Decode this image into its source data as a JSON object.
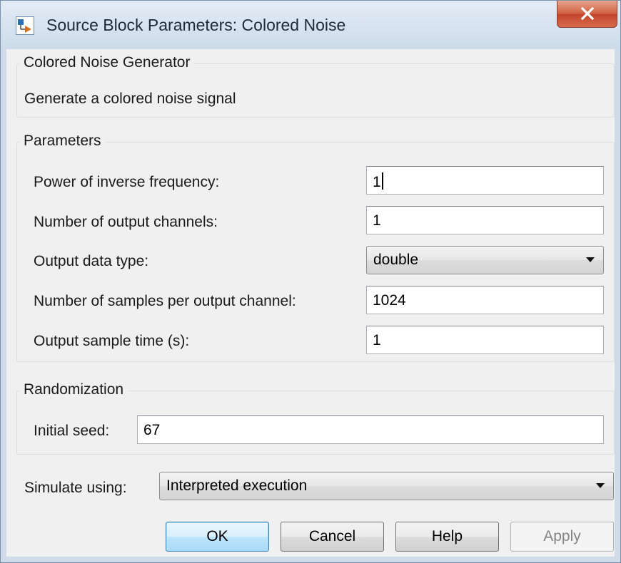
{
  "window": {
    "title": "Source Block Parameters: Colored Noise",
    "close_glyph": "X",
    "icon": "simulink-block-icon"
  },
  "description_group": {
    "title": "Colored Noise Generator",
    "text": "Generate a colored noise signal"
  },
  "parameters_group": {
    "title": "Parameters",
    "power_label": "Power of inverse frequency:",
    "power_value": "1",
    "channels_label": "Number of output channels:",
    "channels_value": "1",
    "datatype_label": "Output data type:",
    "datatype_value": "double",
    "samples_label": "Number of samples per output channel:",
    "samples_value": "1024",
    "sampletime_label": "Output sample time (s):",
    "sampletime_value": "1"
  },
  "randomization_group": {
    "title": "Randomization",
    "seed_label": "Initial seed:",
    "seed_value": "67"
  },
  "simulate": {
    "label": "Simulate using:",
    "value": "Interpreted execution"
  },
  "buttons": {
    "ok": "OK",
    "cancel": "Cancel",
    "help": "Help",
    "apply": "Apply"
  },
  "colors": {
    "titlebar": "#cddbea",
    "close_button": "#c0432a",
    "dialog_background": "#f0f0f0",
    "default_button_border": "#3c7fb1"
  }
}
